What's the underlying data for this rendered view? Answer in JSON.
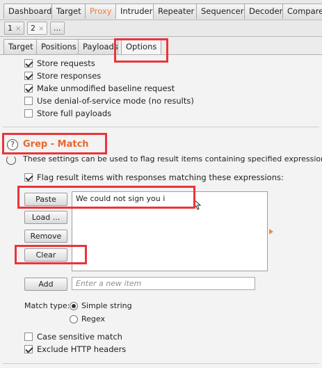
{
  "main_tabs": [
    "Dashboard",
    "Target",
    "Proxy",
    "Intruder",
    "Repeater",
    "Sequencer",
    "Decoder",
    "Comparer"
  ],
  "attack_tabs": [
    "1",
    "2",
    "..."
  ],
  "sub_tabs": [
    "Target",
    "Positions",
    "Payloads",
    "Options"
  ],
  "store_options": [
    {
      "label": "Store requests",
      "checked": true
    },
    {
      "label": "Store responses",
      "checked": true
    },
    {
      "label": "Make unmodified baseline request",
      "checked": true
    },
    {
      "label": "Use denial-of-service mode (no results)",
      "checked": false
    },
    {
      "label": "Store full payloads",
      "checked": false
    }
  ],
  "grep": {
    "title": "Grep - Match",
    "description": "These settings can be used to flag result items containing specified expressions.",
    "flag_label": "Flag result items with responses matching these expressions:",
    "buttons": [
      "Paste",
      "Load ...",
      "Remove",
      "Clear"
    ],
    "items": [
      "We could not sign you i"
    ],
    "add_label": "Add",
    "new_item_placeholder": "Enter a new item",
    "match_type_label": "Match type:",
    "match_types": [
      "Simple string",
      "Regex"
    ],
    "selected_match_type": "Simple string",
    "case_sensitive_label": "Case sensitive match",
    "exclude_headers_label": "Exclude HTTP headers"
  },
  "colors": {
    "accent": "#e8662f",
    "highlight": "#e8353a"
  }
}
